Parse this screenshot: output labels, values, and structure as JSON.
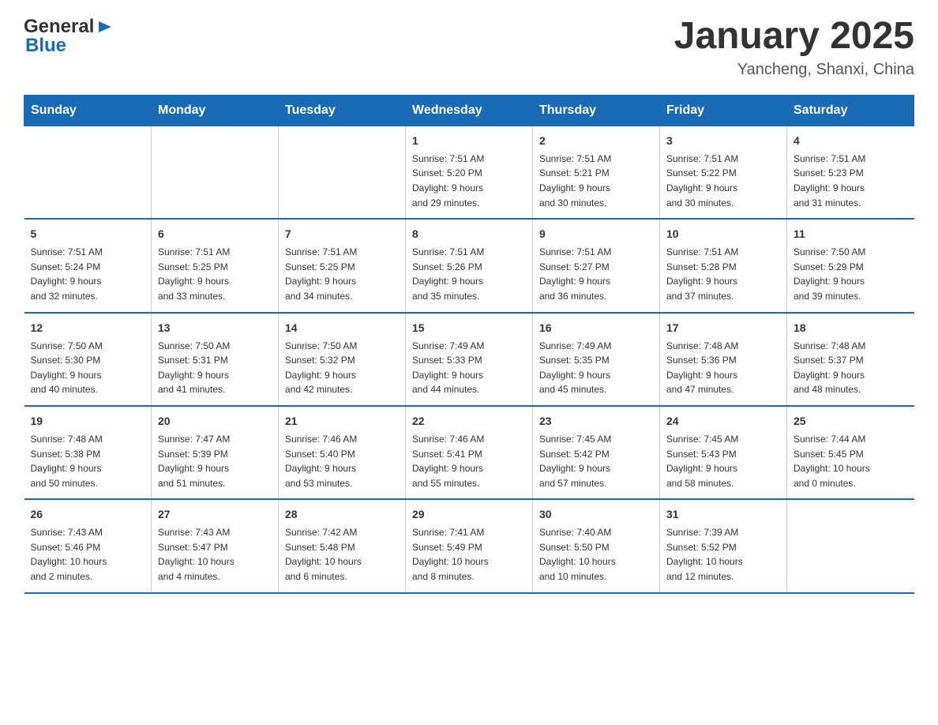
{
  "header": {
    "logo_general": "General",
    "logo_blue": "Blue",
    "month_title": "January 2025",
    "location": "Yancheng, Shanxi, China"
  },
  "calendar": {
    "days_of_week": [
      "Sunday",
      "Monday",
      "Tuesday",
      "Wednesday",
      "Thursday",
      "Friday",
      "Saturday"
    ],
    "weeks": [
      [
        {
          "day": "",
          "info": ""
        },
        {
          "day": "",
          "info": ""
        },
        {
          "day": "",
          "info": ""
        },
        {
          "day": "1",
          "info": "Sunrise: 7:51 AM\nSunset: 5:20 PM\nDaylight: 9 hours\nand 29 minutes."
        },
        {
          "day": "2",
          "info": "Sunrise: 7:51 AM\nSunset: 5:21 PM\nDaylight: 9 hours\nand 30 minutes."
        },
        {
          "day": "3",
          "info": "Sunrise: 7:51 AM\nSunset: 5:22 PM\nDaylight: 9 hours\nand 30 minutes."
        },
        {
          "day": "4",
          "info": "Sunrise: 7:51 AM\nSunset: 5:23 PM\nDaylight: 9 hours\nand 31 minutes."
        }
      ],
      [
        {
          "day": "5",
          "info": "Sunrise: 7:51 AM\nSunset: 5:24 PM\nDaylight: 9 hours\nand 32 minutes."
        },
        {
          "day": "6",
          "info": "Sunrise: 7:51 AM\nSunset: 5:25 PM\nDaylight: 9 hours\nand 33 minutes."
        },
        {
          "day": "7",
          "info": "Sunrise: 7:51 AM\nSunset: 5:25 PM\nDaylight: 9 hours\nand 34 minutes."
        },
        {
          "day": "8",
          "info": "Sunrise: 7:51 AM\nSunset: 5:26 PM\nDaylight: 9 hours\nand 35 minutes."
        },
        {
          "day": "9",
          "info": "Sunrise: 7:51 AM\nSunset: 5:27 PM\nDaylight: 9 hours\nand 36 minutes."
        },
        {
          "day": "10",
          "info": "Sunrise: 7:51 AM\nSunset: 5:28 PM\nDaylight: 9 hours\nand 37 minutes."
        },
        {
          "day": "11",
          "info": "Sunrise: 7:50 AM\nSunset: 5:29 PM\nDaylight: 9 hours\nand 39 minutes."
        }
      ],
      [
        {
          "day": "12",
          "info": "Sunrise: 7:50 AM\nSunset: 5:30 PM\nDaylight: 9 hours\nand 40 minutes."
        },
        {
          "day": "13",
          "info": "Sunrise: 7:50 AM\nSunset: 5:31 PM\nDaylight: 9 hours\nand 41 minutes."
        },
        {
          "day": "14",
          "info": "Sunrise: 7:50 AM\nSunset: 5:32 PM\nDaylight: 9 hours\nand 42 minutes."
        },
        {
          "day": "15",
          "info": "Sunrise: 7:49 AM\nSunset: 5:33 PM\nDaylight: 9 hours\nand 44 minutes."
        },
        {
          "day": "16",
          "info": "Sunrise: 7:49 AM\nSunset: 5:35 PM\nDaylight: 9 hours\nand 45 minutes."
        },
        {
          "day": "17",
          "info": "Sunrise: 7:48 AM\nSunset: 5:36 PM\nDaylight: 9 hours\nand 47 minutes."
        },
        {
          "day": "18",
          "info": "Sunrise: 7:48 AM\nSunset: 5:37 PM\nDaylight: 9 hours\nand 48 minutes."
        }
      ],
      [
        {
          "day": "19",
          "info": "Sunrise: 7:48 AM\nSunset: 5:38 PM\nDaylight: 9 hours\nand 50 minutes."
        },
        {
          "day": "20",
          "info": "Sunrise: 7:47 AM\nSunset: 5:39 PM\nDaylight: 9 hours\nand 51 minutes."
        },
        {
          "day": "21",
          "info": "Sunrise: 7:46 AM\nSunset: 5:40 PM\nDaylight: 9 hours\nand 53 minutes."
        },
        {
          "day": "22",
          "info": "Sunrise: 7:46 AM\nSunset: 5:41 PM\nDaylight: 9 hours\nand 55 minutes."
        },
        {
          "day": "23",
          "info": "Sunrise: 7:45 AM\nSunset: 5:42 PM\nDaylight: 9 hours\nand 57 minutes."
        },
        {
          "day": "24",
          "info": "Sunrise: 7:45 AM\nSunset: 5:43 PM\nDaylight: 9 hours\nand 58 minutes."
        },
        {
          "day": "25",
          "info": "Sunrise: 7:44 AM\nSunset: 5:45 PM\nDaylight: 10 hours\nand 0 minutes."
        }
      ],
      [
        {
          "day": "26",
          "info": "Sunrise: 7:43 AM\nSunset: 5:46 PM\nDaylight: 10 hours\nand 2 minutes."
        },
        {
          "day": "27",
          "info": "Sunrise: 7:43 AM\nSunset: 5:47 PM\nDaylight: 10 hours\nand 4 minutes."
        },
        {
          "day": "28",
          "info": "Sunrise: 7:42 AM\nSunset: 5:48 PM\nDaylight: 10 hours\nand 6 minutes."
        },
        {
          "day": "29",
          "info": "Sunrise: 7:41 AM\nSunset: 5:49 PM\nDaylight: 10 hours\nand 8 minutes."
        },
        {
          "day": "30",
          "info": "Sunrise: 7:40 AM\nSunset: 5:50 PM\nDaylight: 10 hours\nand 10 minutes."
        },
        {
          "day": "31",
          "info": "Sunrise: 7:39 AM\nSunset: 5:52 PM\nDaylight: 10 hours\nand 12 minutes."
        },
        {
          "day": "",
          "info": ""
        }
      ]
    ]
  }
}
